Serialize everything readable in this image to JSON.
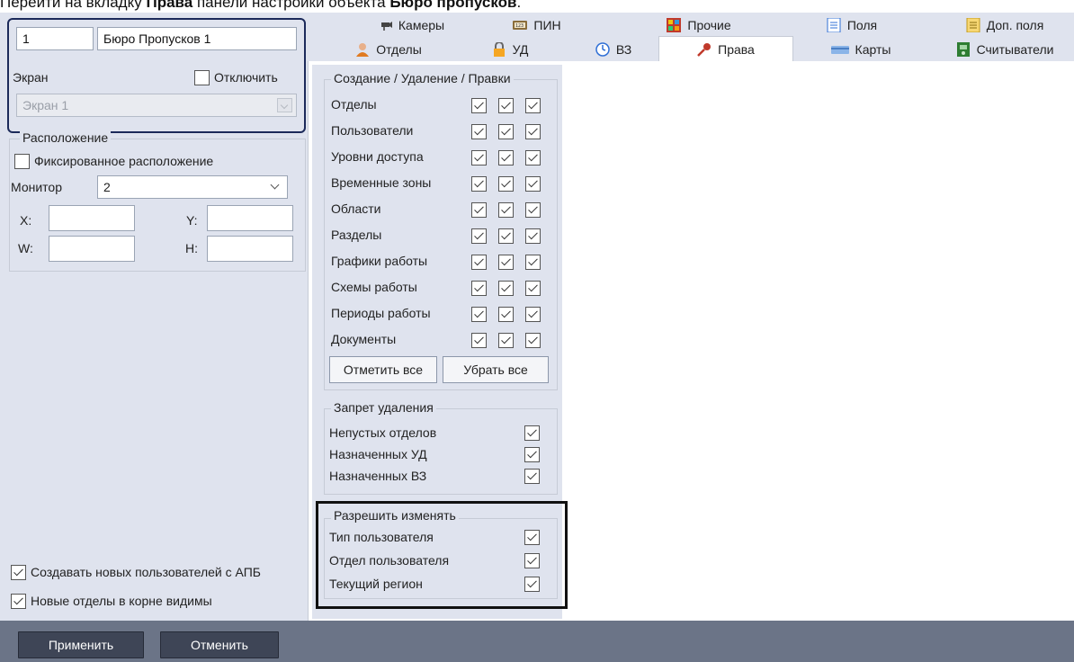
{
  "caption": {
    "prefix": "Перейти на вкладку ",
    "tab": "Права",
    "middle": " панели настройки объекта ",
    "object": "Бюро пропусков",
    "suffix": "."
  },
  "object": {
    "id": "1",
    "name": "Бюро Пропусков 1"
  },
  "screen": {
    "label": "Экран",
    "disable_label": "Отключить",
    "disabled": false,
    "value": "Экран 1"
  },
  "location": {
    "legend": "Расположение",
    "fixed_label": "Фиксированное расположение",
    "fixed": false,
    "monitor_label": "Монитор",
    "monitor_value": "2",
    "x_label": "X:",
    "y_label": "Y:",
    "w_label": "W:",
    "h_label": "H:",
    "x": "",
    "y": "",
    "w": "",
    "h": ""
  },
  "options": [
    {
      "label": "Создавать новых пользователей с АПБ",
      "checked": true
    },
    {
      "label": "Новые отделы в корне видимы",
      "checked": true
    }
  ],
  "tabs_row1": [
    {
      "label": "Камеры",
      "icon": "camera-icon"
    },
    {
      "label": "ПИН",
      "icon": "pin-keypad-icon"
    },
    {
      "label": "Прочие",
      "icon": "misc-icon"
    },
    {
      "label": "Поля",
      "icon": "fields-list-icon"
    },
    {
      "label": "Доп. поля",
      "icon": "extra-fields-icon"
    }
  ],
  "tabs_row2": [
    {
      "label": "Отделы",
      "icon": "user-icon"
    },
    {
      "label": "УД",
      "icon": "lock-icon"
    },
    {
      "label": "ВЗ",
      "icon": "clock-icon"
    },
    {
      "label": "Права",
      "icon": "key-icon",
      "active": true
    },
    {
      "label": "Карты",
      "icon": "card-icon"
    },
    {
      "label": "Считыватели",
      "icon": "reader-icon"
    }
  ],
  "permissions": {
    "legend": "Создание / Удаление / Правки",
    "rows": [
      {
        "label": "Отделы",
        "create": true,
        "delete": true,
        "edit": true
      },
      {
        "label": "Пользователи",
        "create": true,
        "delete": true,
        "edit": true
      },
      {
        "label": "Уровни доступа",
        "create": true,
        "delete": true,
        "edit": true
      },
      {
        "label": "Временные зоны",
        "create": true,
        "delete": true,
        "edit": true
      },
      {
        "label": "Области",
        "create": true,
        "delete": true,
        "edit": true
      },
      {
        "label": "Разделы",
        "create": true,
        "delete": true,
        "edit": true
      },
      {
        "label": "Графики работы",
        "create": true,
        "delete": true,
        "edit": true
      },
      {
        "label": "Схемы работы",
        "create": true,
        "delete": true,
        "edit": true
      },
      {
        "label": "Периоды работы",
        "create": true,
        "delete": true,
        "edit": true
      },
      {
        "label": "Документы",
        "create": true,
        "delete": true,
        "edit": true
      }
    ],
    "select_all": "Отметить все",
    "clear_all": "Убрать все"
  },
  "delete_ban": {
    "legend": "Запрет удаления",
    "rows": [
      {
        "label": "Непустых отделов",
        "checked": true
      },
      {
        "label": "Назначенных УД",
        "checked": true
      },
      {
        "label": "Назначенных ВЗ",
        "checked": true
      }
    ]
  },
  "allow_change": {
    "legend": "Разрешить изменять",
    "rows": [
      {
        "label": "Тип пользователя",
        "checked": true
      },
      {
        "label": "Отдел пользователя",
        "checked": true
      },
      {
        "label": "Текущий регион",
        "checked": true
      }
    ]
  },
  "actions": {
    "apply": "Применить",
    "cancel": "Отменить"
  }
}
